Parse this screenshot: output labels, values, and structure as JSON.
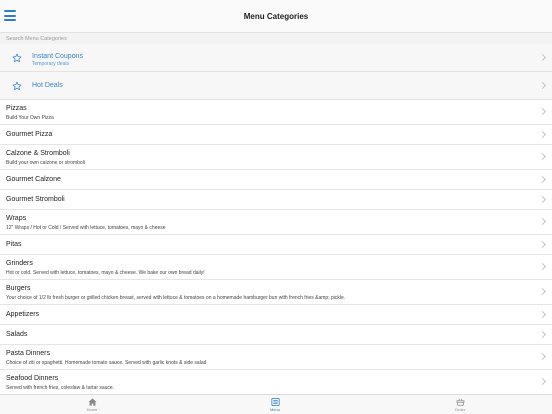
{
  "header": {
    "title": "Menu Categories",
    "menu_icon": "hamburger-icon"
  },
  "search": {
    "placeholder": "Search Menu Categories"
  },
  "promos": [
    {
      "title": "Instant Coupons",
      "subtitle": "Temporary deals",
      "icon": "star-icon"
    },
    {
      "title": "Hot Deals",
      "subtitle": "",
      "icon": "star-icon"
    }
  ],
  "categories": [
    {
      "title": "Pizzas",
      "subtitle": "Build Your Own Pizza"
    },
    {
      "title": "Gourmet Pizza",
      "subtitle": ""
    },
    {
      "title": "Calzone & Stromboli",
      "subtitle": "Build your own calzone or stromboli"
    },
    {
      "title": "Gourmet Calzone",
      "subtitle": ""
    },
    {
      "title": "Gourmet Stromboli",
      "subtitle": ""
    },
    {
      "title": "Wraps",
      "subtitle": "12\" Wraps / Hot or Cold / Served with lettuce, tomatoes, mayo & cheese"
    },
    {
      "title": "Pitas",
      "subtitle": ""
    },
    {
      "title": "Grinders",
      "subtitle": "Hot or cold. Served with lettuce, tomatoes, mayo & cheese. We bake our own bread daily!"
    },
    {
      "title": "Burgers",
      "subtitle": "Your choice of 1/2 lb fresh burger or grilled chicken breast, served with lettuce & tomatoes on a homemade hamburger bun with french fries &amp; pickle."
    },
    {
      "title": "Appetizers",
      "subtitle": ""
    },
    {
      "title": "Salads",
      "subtitle": ""
    },
    {
      "title": "Pasta Dinners",
      "subtitle": "Choice of ziti or spaghetti. Homemade tomato sauce. Served with garlic knots & side salad"
    },
    {
      "title": "Seafood Dinners",
      "subtitle": "Served with french fries, coleslaw & tartar sauce."
    },
    {
      "title": "",
      "subtitle": ""
    }
  ],
  "tabs": [
    {
      "label": "Home",
      "icon": "home-icon",
      "active": false
    },
    {
      "label": "Menu",
      "icon": "menu-list-icon",
      "active": true
    },
    {
      "label": "Order",
      "icon": "basket-icon",
      "active": false
    }
  ],
  "colors": {
    "accent": "#2f7dc4",
    "promo_text": "#3a83c4",
    "divider": "#e5e5e5"
  }
}
